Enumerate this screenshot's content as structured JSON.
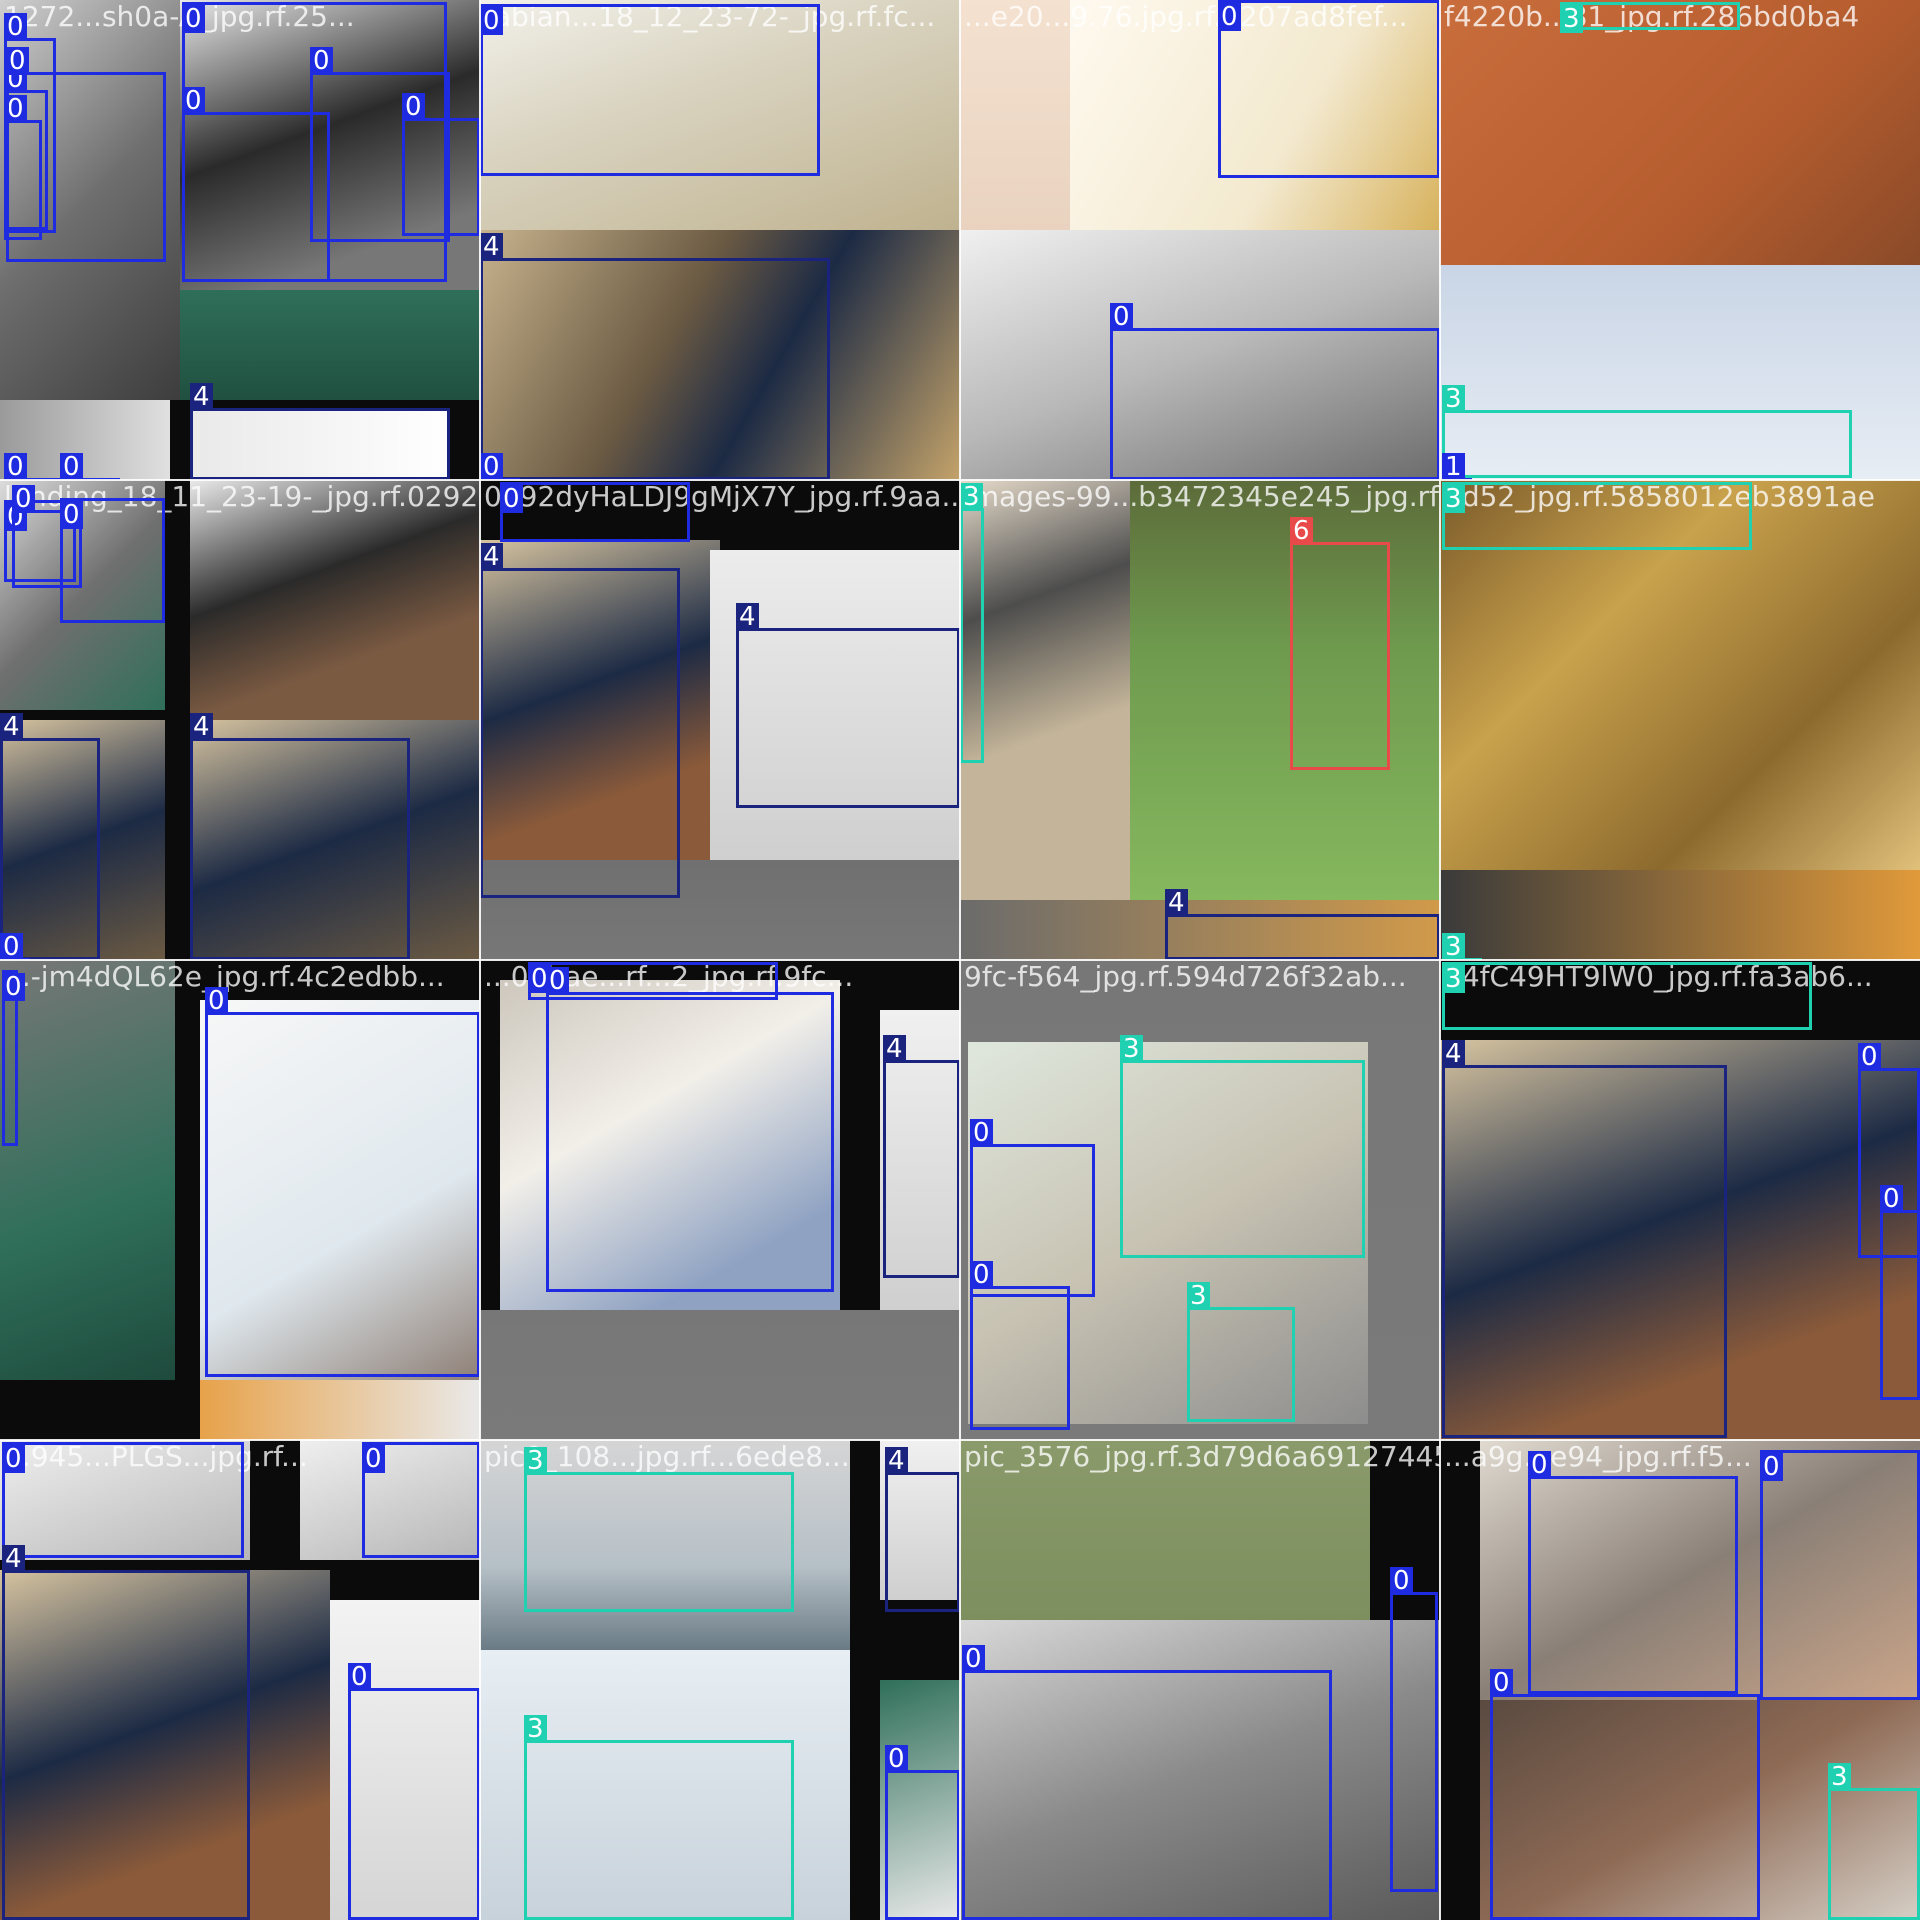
{
  "image_type": "object-detection training batch mosaic (4x4 tiles)",
  "class_colors": {
    "0": "#1f2be0",
    "3": "#1fd1b0",
    "4": "#1a237e",
    "6": "#e84a4a"
  },
  "tiles": [
    {
      "id": "r0c0",
      "filename": "1272...sh0a-A_jpg.rf.25...",
      "boxes": [
        {
          "label": "0"
        },
        {
          "label": "0"
        },
        {
          "label": "0"
        },
        {
          "label": "0"
        },
        {
          "label": "0"
        },
        {
          "label": "0"
        },
        {
          "label": "0"
        },
        {
          "label": "0"
        },
        {
          "label": "4"
        },
        {
          "label": "0"
        },
        {
          "label": "0"
        }
      ]
    },
    {
      "id": "r0c1",
      "filename": "fabian...18_12_23-72-_jpg.rf.fc...",
      "boxes": [
        {
          "label": "0"
        },
        {
          "label": "4"
        },
        {
          "label": "0"
        }
      ]
    },
    {
      "id": "r0c2",
      "filename": "...e20...9.76.jpg.rf.0207ad8fef...",
      "boxes": [
        {
          "label": "0"
        },
        {
          "label": "0"
        }
      ]
    },
    {
      "id": "r0c3",
      "filename": "f4220b...81_jpg.rf.286bd0ba4",
      "boxes": [
        {
          "label": "3"
        },
        {
          "label": "3"
        },
        {
          "label": "1"
        }
      ]
    },
    {
      "id": "r1c0",
      "filename": "landing_18_11_23-19-_jpg.rf.0292...",
      "boxes": [
        {
          "label": "0"
        },
        {
          "label": "0"
        },
        {
          "label": "0"
        },
        {
          "label": "4"
        },
        {
          "label": "4"
        },
        {
          "label": "0"
        }
      ]
    },
    {
      "id": "r1c1",
      "filename": "0292dyHaLDJ9gMjX7Y_jpg.rf.9aa...",
      "boxes": [
        {
          "label": "0"
        },
        {
          "label": "4"
        },
        {
          "label": "4"
        }
      ]
    },
    {
      "id": "r1c2",
      "filename": "images-99...b3472345e245_jpg.rf.5...",
      "boxes": [
        {
          "label": "3"
        },
        {
          "label": "6"
        },
        {
          "label": "4"
        }
      ]
    },
    {
      "id": "r1c3",
      "filename": "2d52_jpg.rf.5858012eb3891ae",
      "boxes": [
        {
          "label": "3"
        },
        {
          "label": "3"
        }
      ]
    },
    {
      "id": "r2c0",
      "filename": "...-jm4dQL62e_jpg.rf.4c2edbb...",
      "boxes": [
        {
          "label": "0"
        },
        {
          "label": "0"
        }
      ]
    },
    {
      "id": "r2c1",
      "filename": "...03bae...rf...2_jpg.rf.9fc...",
      "boxes": [
        {
          "label": "0"
        },
        {
          "label": "0"
        },
        {
          "label": "4"
        }
      ]
    },
    {
      "id": "r2c2",
      "filename": "9fc-f564_jpg.rf.594d726f32ab...",
      "boxes": [
        {
          "label": "3"
        },
        {
          "label": "0"
        },
        {
          "label": "0"
        },
        {
          "label": "3"
        }
      ]
    },
    {
      "id": "r2c3",
      "filename": "74fC49HT9lW0_jpg.rf.fa3ab6...",
      "boxes": [
        {
          "label": "3"
        },
        {
          "label": "4"
        },
        {
          "label": "0"
        },
        {
          "label": "0"
        }
      ]
    },
    {
      "id": "r3c0",
      "filename": "...945...PLGS...jpg.rf...",
      "boxes": [
        {
          "label": "0"
        },
        {
          "label": "0"
        },
        {
          "label": "4"
        },
        {
          "label": "0"
        }
      ]
    },
    {
      "id": "r3c1",
      "filename": "pic0_108...jpg.rf...6ede8...",
      "boxes": [
        {
          "label": "3"
        },
        {
          "label": "4"
        },
        {
          "label": "3"
        },
        {
          "label": "0"
        }
      ]
    },
    {
      "id": "r3c2",
      "filename": "pic_3576_jpg.rf.3d79d6a69127445...",
      "boxes": [
        {
          "label": "0"
        },
        {
          "label": "0"
        }
      ]
    },
    {
      "id": "r3c3",
      "filename": "...a9g...e94_jpg.rf.f5...",
      "boxes": [
        {
          "label": "0"
        },
        {
          "label": "0"
        },
        {
          "label": "0"
        },
        {
          "label": "3"
        }
      ]
    }
  ]
}
